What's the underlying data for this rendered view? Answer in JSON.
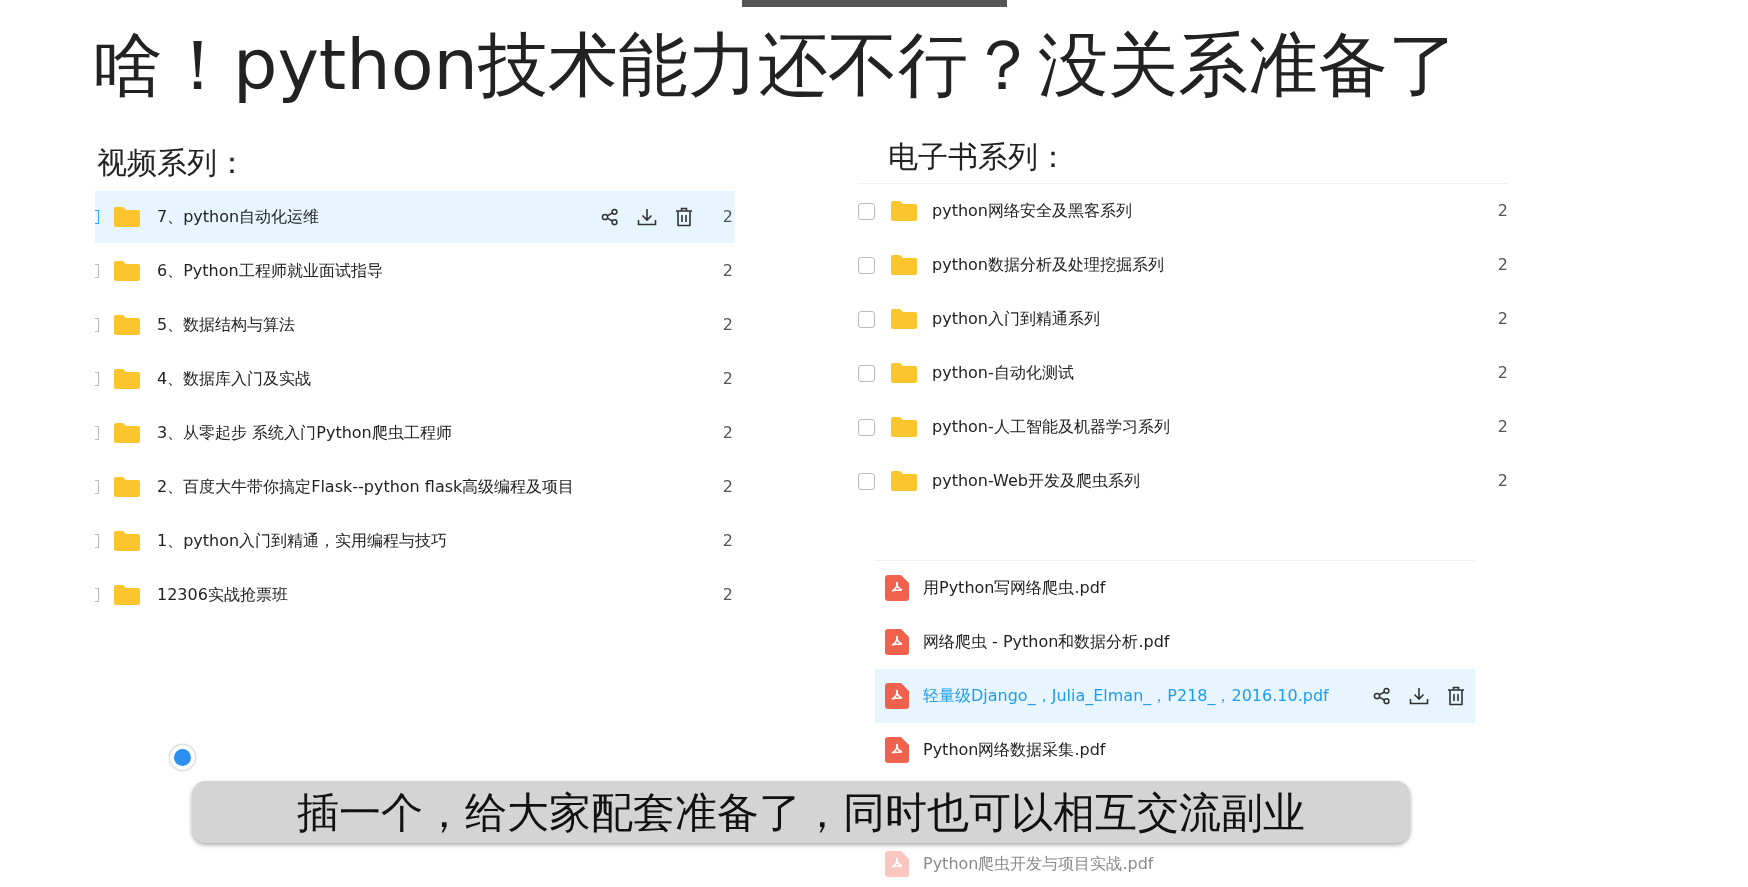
{
  "title": "啥！python技术能力还不行？没关系准备了",
  "video_series": {
    "heading": "视频系列：",
    "rows": [
      {
        "name": "7、python自动化运维",
        "size": "2",
        "selected": true
      },
      {
        "name": "6、Python工程师就业面试指导",
        "size": "2",
        "selected": false
      },
      {
        "name": "5、数据结构与算法",
        "size": "2",
        "selected": false
      },
      {
        "name": "4、数据库入门及实战",
        "size": "2",
        "selected": false
      },
      {
        "name": "3、从零起步 系统入门Python爬虫工程师",
        "size": "2",
        "selected": false
      },
      {
        "name": "2、百度大牛带你搞定Flask--python flask高级编程及项目",
        "size": "2",
        "selected": false
      },
      {
        "name": "1、python入门到精通，实用编程与技巧",
        "size": "2",
        "selected": false
      },
      {
        "name": "12306实战抢票班",
        "size": "2",
        "selected": false
      }
    ]
  },
  "ebook_series": {
    "heading": "电子书系列：",
    "folders": [
      {
        "name": "python网络安全及黑客系列",
        "size": "2",
        "checked": false
      },
      {
        "name": "python数据分析及处理挖掘系列",
        "size": "2",
        "checked": false
      },
      {
        "name": "python入门到精通系列",
        "size": "2",
        "checked": false
      },
      {
        "name": "python-自动化测试",
        "size": "2",
        "checked": false
      },
      {
        "name": "python-人工智能及机器学习系列",
        "size": "2",
        "checked": false
      },
      {
        "name": "python-Web开发及爬虫系列",
        "size": "2",
        "checked": false
      }
    ],
    "files": [
      {
        "name": "用Python写网络爬虫.pdf",
        "selected": false
      },
      {
        "name": "网络爬虫 - Python和数据分析.pdf",
        "selected": false
      },
      {
        "name": "轻量级Django_，Julia_Elman_，P218_，2016.10.pdf",
        "selected": true
      },
      {
        "name": "Python网络数据采集.pdf",
        "selected": false
      }
    ],
    "faded_file": "Python爬虫开发与项目实战.pdf"
  },
  "subtitle": "插一个，给大家配套准备了，同时也可以相互交流副业"
}
